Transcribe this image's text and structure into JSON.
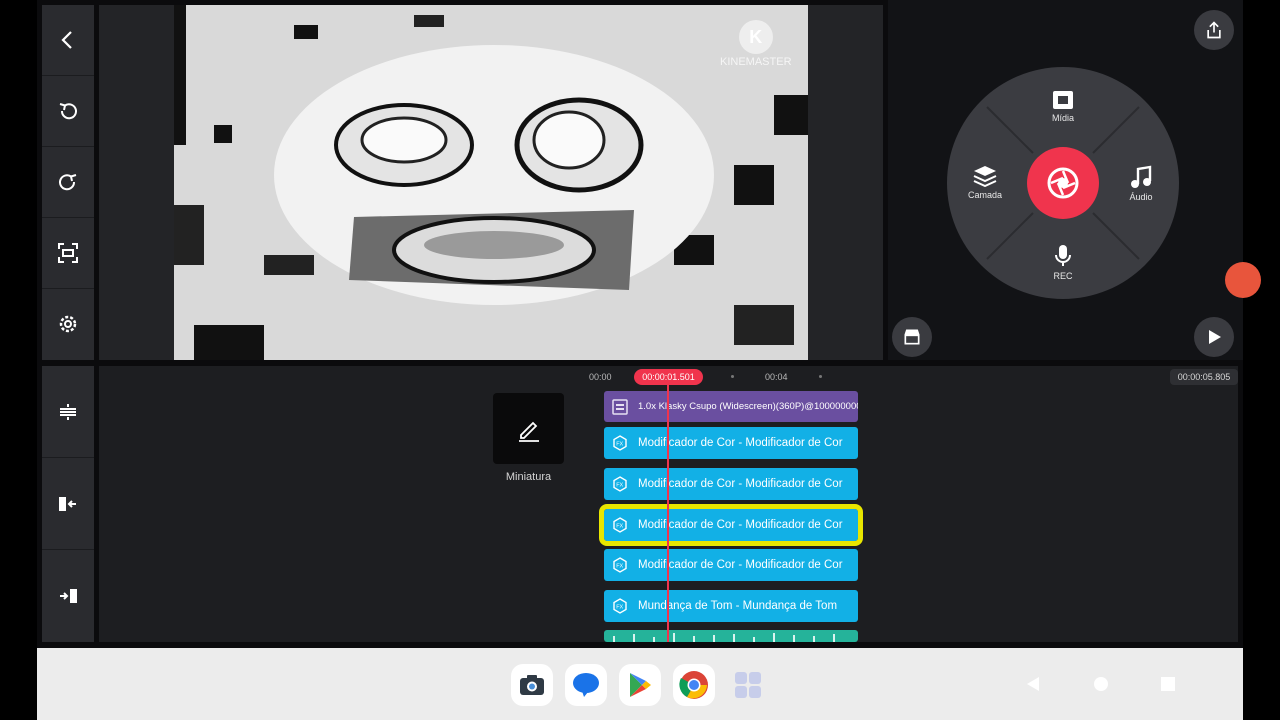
{
  "watermark": {
    "brand": "KINEMASTER",
    "logo_letter": "K"
  },
  "left_toolbar_top": [
    {
      "icon": "back-chevron-icon"
    },
    {
      "icon": "undo-icon"
    },
    {
      "icon": "redo-icon"
    },
    {
      "icon": "capture-frame-icon"
    },
    {
      "icon": "settings-gear-icon"
    }
  ],
  "left_toolbar_bottom": [
    {
      "icon": "split-layers-icon"
    },
    {
      "icon": "trim-left-icon"
    },
    {
      "icon": "trim-right-icon"
    }
  ],
  "media_wheel": {
    "media_label": "Mídia",
    "layer_label": "Camada",
    "audio_label": "Áudio",
    "rec_label": "REC"
  },
  "timeline": {
    "time_start": "00:00",
    "time_current": "00:00:01.501",
    "time_mid": "00:04",
    "time_total": "00:00:05.805",
    "thumbnail_label": "Miniatura"
  },
  "tracks": [
    {
      "type": "video",
      "label": "1.0x Klasky Csupo (Widescreen)(360P)@1000000000"
    },
    {
      "type": "fx",
      "label": "Modificador de Cor - Modificador de Cor"
    },
    {
      "type": "fx",
      "label": "Modificador de Cor - Modificador de Cor"
    },
    {
      "type": "fx",
      "label": "Modificador de Cor - Modificador de Cor",
      "selected": true
    },
    {
      "type": "fx",
      "label": "Modificador de Cor - Modificador de Cor"
    },
    {
      "type": "fx",
      "label": "Mundança de Tom - Mundança de Tom"
    }
  ],
  "colors": {
    "accent_red": "#f0344d",
    "fx_blue": "#12b0e6",
    "video_purple": "#6a4fa0",
    "selection_yellow": "#e8e600",
    "audio_teal": "#25b39a"
  },
  "dock": [
    {
      "icon": "camera-app-icon"
    },
    {
      "icon": "messages-app-icon"
    },
    {
      "icon": "play-store-icon"
    },
    {
      "icon": "chrome-icon"
    },
    {
      "icon": "app-drawer-icon"
    }
  ]
}
